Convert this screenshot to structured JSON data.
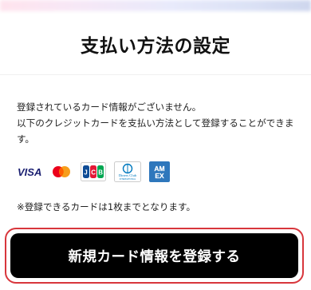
{
  "header": {
    "title": "支払い方法の設定"
  },
  "message": {
    "line1": "登録されているカード情報がございません。",
    "line2": "以下のクレジットカードを支払い方法として登録することができます。"
  },
  "cards": [
    {
      "name": "VISA",
      "icon": "visa-icon"
    },
    {
      "name": "Mastercard",
      "icon": "mastercard-icon"
    },
    {
      "name": "JCB",
      "icon": "jcb-icon"
    },
    {
      "name": "Diners Club",
      "icon": "diners-club-icon",
      "text": "Diners Club"
    },
    {
      "name": "American Express",
      "icon": "amex-icon",
      "text": "AM EX"
    }
  ],
  "note": "※登録できるカードは1枚までとなります。",
  "button": {
    "label": "新規カード情報を登録する"
  },
  "colors": {
    "highlight": "#d8363c",
    "button_bg": "#000000",
    "visa": "#1a1f71",
    "amex": "#2e77bc"
  }
}
